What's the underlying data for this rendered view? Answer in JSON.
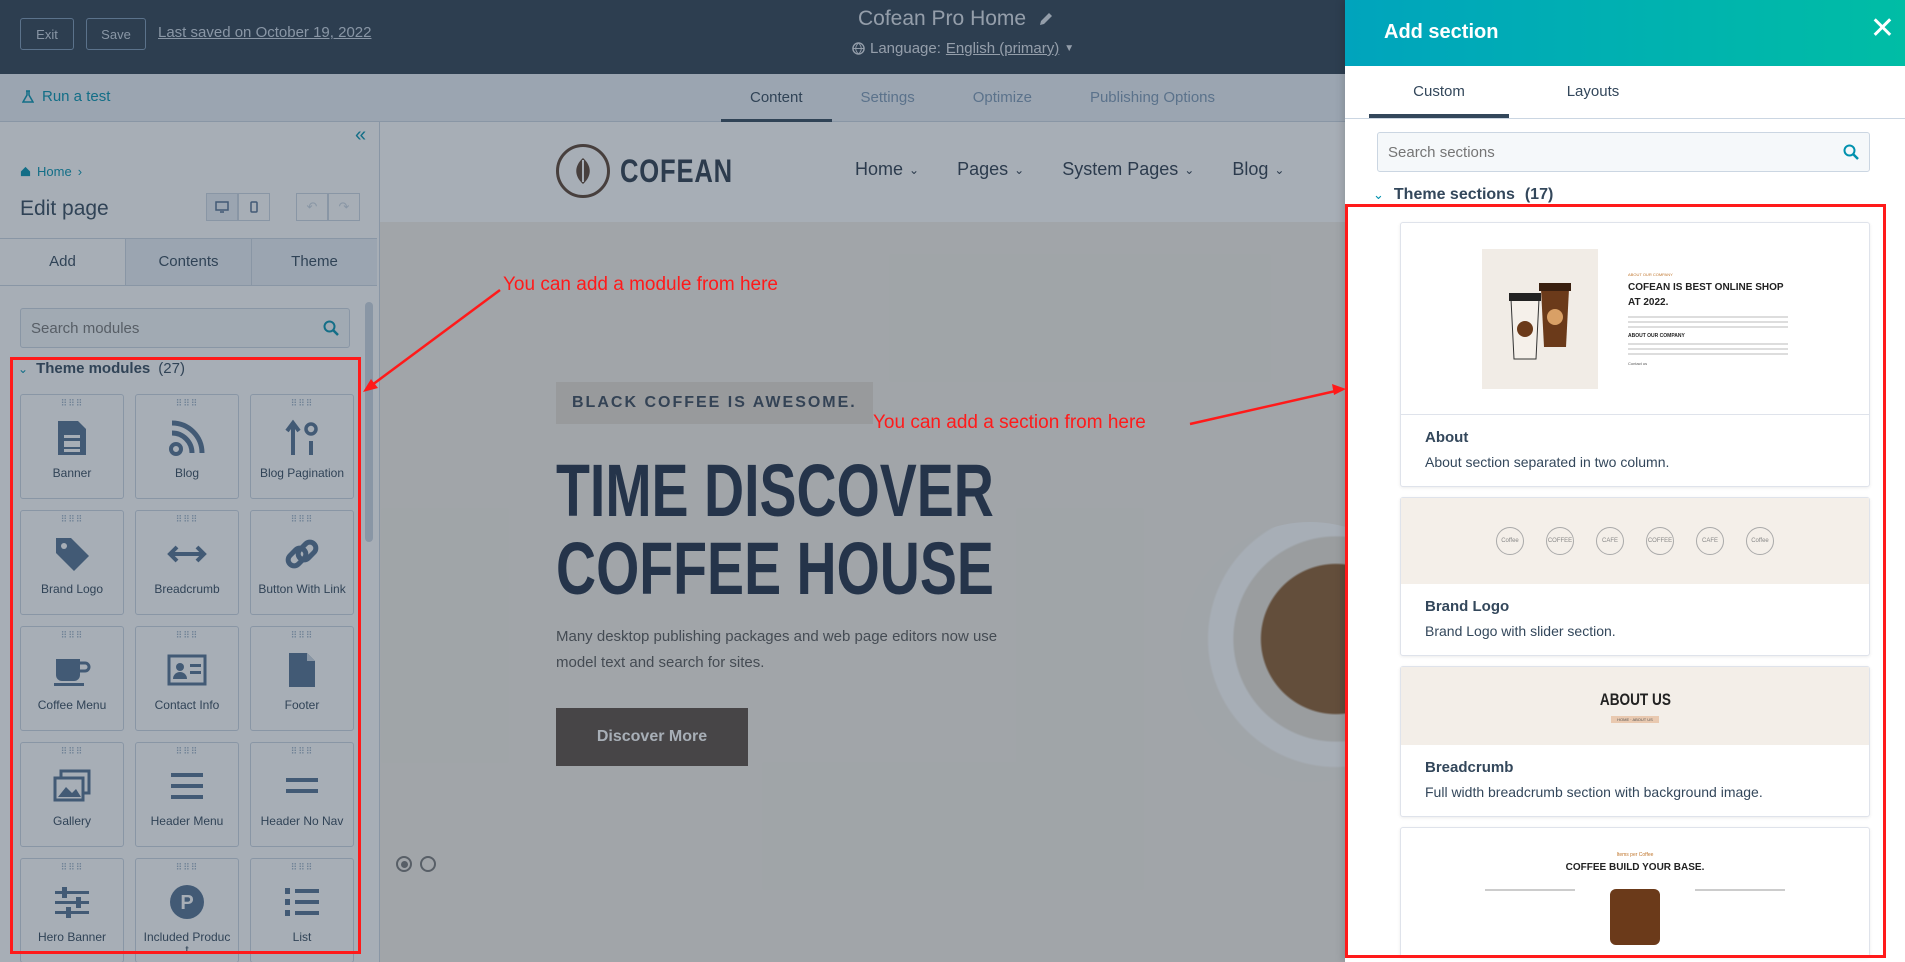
{
  "topbar": {
    "exit_label": "Exit",
    "save_label": "Save",
    "last_saved": "Last saved on October 19, 2022",
    "page_name": "Cofean Pro Home",
    "language_prefix": "Language:",
    "language_value": "English (primary)"
  },
  "subbar": {
    "run_test": "Run a test",
    "tabs": [
      "Content",
      "Settings",
      "Optimize",
      "Publishing Options"
    ],
    "active_tab": "Content"
  },
  "sidebar": {
    "breadcrumb_home": "Home",
    "title": "Edit page",
    "tabs": [
      "Add",
      "Contents",
      "Theme"
    ],
    "search_placeholder": "Search modules",
    "theme_modules_label": "Theme modules",
    "theme_modules_count": "(27)",
    "modules": [
      {
        "label": "Banner",
        "icon": "document-icon"
      },
      {
        "label": "Blog",
        "icon": "blog-icon"
      },
      {
        "label": "Blog Pagination",
        "icon": "pagination-icon"
      },
      {
        "label": "Brand Logo",
        "icon": "tag-icon"
      },
      {
        "label": "Breadcrumb",
        "icon": "arrows-horizontal-icon"
      },
      {
        "label": "Button With Link",
        "icon": "link-icon"
      },
      {
        "label": "Coffee Menu",
        "icon": "coffee-cup-icon"
      },
      {
        "label": "Contact Info",
        "icon": "contact-card-icon"
      },
      {
        "label": "Footer",
        "icon": "file-icon"
      },
      {
        "label": "Gallery",
        "icon": "gallery-icon"
      },
      {
        "label": "Header Menu",
        "icon": "menu-lines-icon"
      },
      {
        "label": "Header No Nav",
        "icon": "two-lines-icon"
      },
      {
        "label": "Hero Banner",
        "icon": "sliders-icon"
      },
      {
        "label": "Included Produc\nt",
        "icon": "p-circle-icon"
      },
      {
        "label": "List",
        "icon": "numbered-list-icon"
      }
    ]
  },
  "canvas": {
    "logo_text": "COFEAN",
    "nav": [
      "Home",
      "Pages",
      "System Pages",
      "Blog"
    ],
    "badge": "BLACK COFFEE IS AWESOME.",
    "heading_line1": "TIME DISCOVER",
    "heading_line2": "COFFEE HOUSE",
    "paragraph": "Many desktop publishing packages and web page editors now use model text and search for sites.",
    "cta": "Discover More"
  },
  "panel": {
    "title": "Add section",
    "tabs": [
      "Custom",
      "Layouts"
    ],
    "active_tab": "Custom",
    "search_placeholder": "Search sections",
    "theme_sections_label": "Theme sections",
    "theme_sections_count": "(17)",
    "sections": [
      {
        "name": "About",
        "description": "About section separated in two column.",
        "thumb_kicker": "ABOUT OUR COMPANY",
        "thumb_title": "COFEAN IS BEST ONLINE SHOP AT 2022.",
        "thumb_subtitle": "ABOUT OUR COMPANY",
        "thumb_link": "Contact us"
      },
      {
        "name": "Brand Logo",
        "description": "Brand Logo with slider section.",
        "thumb_logos": [
          "Coffee",
          "COFFEE",
          "CAFE",
          "COFFEE",
          "CAFE",
          "Coffee"
        ]
      },
      {
        "name": "Breadcrumb",
        "description": "Full width breadcrumb section with background image.",
        "thumb_title": "ABOUT US",
        "thumb_crumb": "HOME · ABOUT US"
      },
      {
        "name": "",
        "description": "",
        "thumb_kicker": "Items per Coffee",
        "thumb_title": "COFFEE BUILD YOUR BASE."
      }
    ]
  },
  "annotations": {
    "module_note": "You can add a module from here",
    "section_note": "You can add a section from here",
    "color": "#ff1a1a"
  }
}
